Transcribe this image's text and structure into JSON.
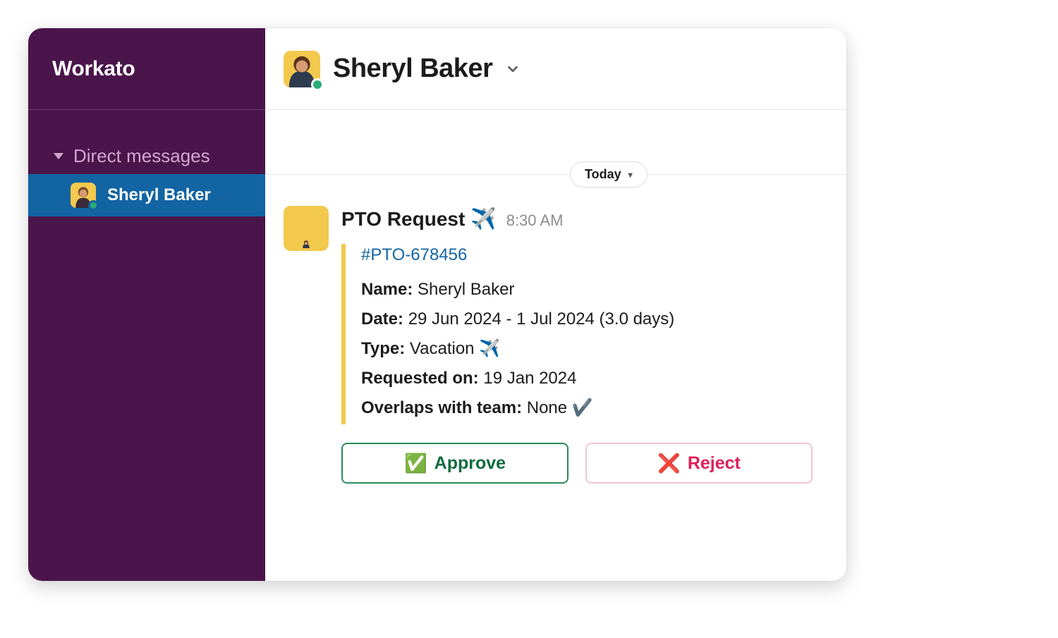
{
  "workspace": {
    "name": "Workato"
  },
  "sidebar": {
    "section_label": "Direct messages",
    "dm": {
      "name": "Sheryl Baker"
    }
  },
  "header": {
    "user": "Sheryl Baker"
  },
  "divider": {
    "label": "Today"
  },
  "message": {
    "title": "PTO Request",
    "title_emoji": "✈️",
    "time": "8:30 AM",
    "ticket": "#PTO-678456",
    "fields": {
      "name_label": "Name:",
      "name_value": "Sheryl Baker",
      "date_label": "Date:",
      "date_value": "29 Jun 2024 - 1 Jul 2024 (3.0 days)",
      "type_label": "Type:",
      "type_value": "Vacation ✈️",
      "requested_label": "Requested on:",
      "requested_value": "19 Jan 2024",
      "overlaps_label": "Overlaps with team:",
      "overlaps_value": "None ✔️"
    },
    "actions": {
      "approve_emoji": "✅",
      "approve": "Approve",
      "reject_emoji": "❌",
      "reject": "Reject"
    }
  }
}
